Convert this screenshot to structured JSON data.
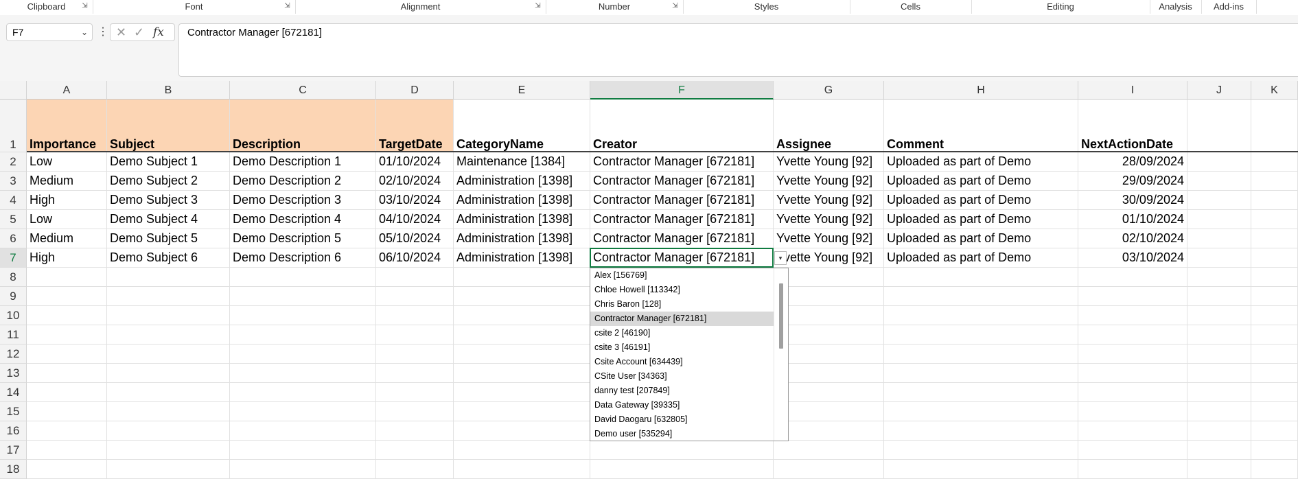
{
  "ribbon": {
    "groups": [
      {
        "label": "Clipboard",
        "launcher": true
      },
      {
        "label": "Font",
        "launcher": true
      },
      {
        "label": "Alignment",
        "launcher": true
      },
      {
        "label": "Number",
        "launcher": true
      },
      {
        "label": "Styles",
        "launcher": false
      },
      {
        "label": "Cells",
        "launcher": false
      },
      {
        "label": "Editing",
        "launcher": false
      },
      {
        "label": "Analysis",
        "launcher": false
      },
      {
        "label": "Add-ins",
        "launcher": false
      }
    ]
  },
  "namebox": {
    "value": "F7"
  },
  "formula": {
    "value": "Contractor Manager [672181]"
  },
  "columns": [
    "A",
    "B",
    "C",
    "D",
    "E",
    "F",
    "G",
    "H",
    "I",
    "J",
    "K"
  ],
  "selected_column": "F",
  "rows": [
    "1",
    "2",
    "3",
    "4",
    "5",
    "6",
    "7",
    "8",
    "9",
    "10",
    "11",
    "12",
    "13",
    "14",
    "15",
    "16",
    "17",
    "18"
  ],
  "selected_row": "7",
  "headers": [
    "Importance",
    "Subject",
    "Description",
    "TargetDate",
    "CategoryName",
    "Creator",
    "Assignee",
    "Comment",
    "NextActionDate"
  ],
  "data": [
    [
      "Low",
      "Demo Subject 1",
      "Demo Description 1",
      "01/10/2024",
      "Maintenance [1384]",
      "Contractor Manager [672181]",
      "Yvette Young [92]",
      "Uploaded as part of Demo",
      "28/09/2024"
    ],
    [
      "Medium",
      "Demo Subject 2",
      "Demo Description 2",
      "02/10/2024",
      "Administration [1398]",
      "Contractor Manager [672181]",
      "Yvette Young [92]",
      "Uploaded as part of Demo",
      "29/09/2024"
    ],
    [
      "High",
      "Demo Subject 3",
      "Demo Description 3",
      "03/10/2024",
      "Administration [1398]",
      "Contractor Manager [672181]",
      "Yvette Young [92]",
      "Uploaded as part of Demo",
      "30/09/2024"
    ],
    [
      "Low",
      "Demo Subject 4",
      "Demo Description 4",
      "04/10/2024",
      "Administration [1398]",
      "Contractor Manager [672181]",
      "Yvette Young [92]",
      "Uploaded as part of Demo",
      "01/10/2024"
    ],
    [
      "Medium",
      "Demo Subject 5",
      "Demo Description 5",
      "05/10/2024",
      "Administration [1398]",
      "Contractor Manager [672181]",
      "Yvette Young [92]",
      "Uploaded as part of Demo",
      "02/10/2024"
    ],
    [
      "High",
      "Demo Subject 6",
      "Demo Description 6",
      "06/10/2024",
      "Administration [1398]",
      "Contractor Manager [672181]",
      "Yvette Young [92]",
      "Uploaded as part of Demo",
      "03/10/2024"
    ]
  ],
  "dropdown": {
    "items": [
      "Alex [156769]",
      "Chloe Howell [113342]",
      "Chris Baron [128]",
      "Contractor Manager [672181]",
      "csite 2 [46190]",
      "csite 3 [46191]",
      "Csite Account [634439]",
      "CSite User [34363]",
      "danny test [207849]",
      "Data Gateway [39335]",
      "David Daogaru [632805]",
      "Demo user [535294]"
    ],
    "selected": "Contractor Manager [672181]"
  },
  "colors": {
    "header_fill": "#fcd5b4",
    "accent": "#107c41"
  }
}
